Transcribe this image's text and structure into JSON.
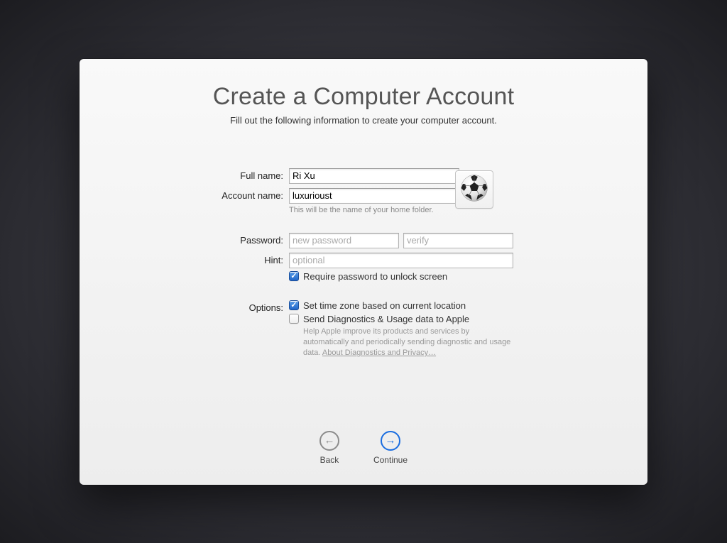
{
  "header": {
    "title": "Create a Computer Account",
    "subtitle": "Fill out the following information to create your computer account."
  },
  "form": {
    "full_name": {
      "label": "Full name:",
      "value": "Ri Xu"
    },
    "account_name": {
      "label": "Account name:",
      "value": "luxurioust",
      "hint": "This will be the name of your home folder."
    },
    "password": {
      "label": "Password:",
      "placeholder_new": "new password",
      "placeholder_verify": "verify"
    },
    "hint_field": {
      "label": "Hint:",
      "placeholder": "optional"
    },
    "require_password": {
      "checked": true,
      "label": "Require password to unlock screen"
    },
    "options": {
      "label": "Options:",
      "timezone": {
        "checked": true,
        "label": "Set time zone based on current location"
      },
      "diagnostics": {
        "checked": false,
        "label": "Send Diagnostics & Usage data to Apple",
        "desc_pre": "Help Apple improve its products and services by automatically and periodically sending diagnostic and usage data. ",
        "link": "About Diagnostics and Privacy…"
      }
    }
  },
  "avatar": {
    "icon_name": "soccer-ball"
  },
  "nav": {
    "back": "Back",
    "continue": "Continue"
  }
}
